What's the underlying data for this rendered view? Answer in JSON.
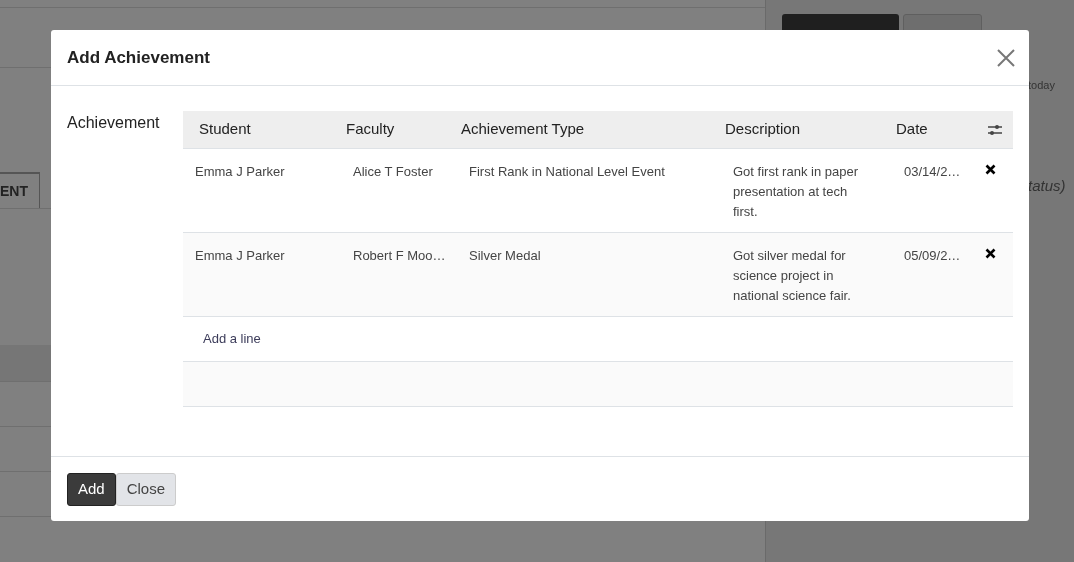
{
  "background": {
    "tab": "ENT",
    "timeline_label": "today",
    "status_text": "tatus)"
  },
  "dialog": {
    "title": "Add Achievement",
    "field_label": "Achievement",
    "columns": [
      "Student",
      "Faculty",
      "Achievement Type",
      "Description",
      "Date"
    ],
    "rows": [
      {
        "student": "Emma J Parker",
        "faculty": "Alice T Foster",
        "achievement_type": "First Rank in National Level Event",
        "description": "Got first rank in paper presentation at tech first.",
        "date": "03/14/2…"
      },
      {
        "student": "Emma J Parker",
        "faculty": "Robert F Moo…",
        "achievement_type": "Silver Medal",
        "description": "Got silver medal for science project in national science fair.",
        "date": "05/09/2…"
      }
    ],
    "add_line": "Add a line",
    "buttons": [
      {
        "label": "Add",
        "kind": "primary"
      },
      {
        "label": "Close",
        "kind": "secondary"
      }
    ]
  }
}
